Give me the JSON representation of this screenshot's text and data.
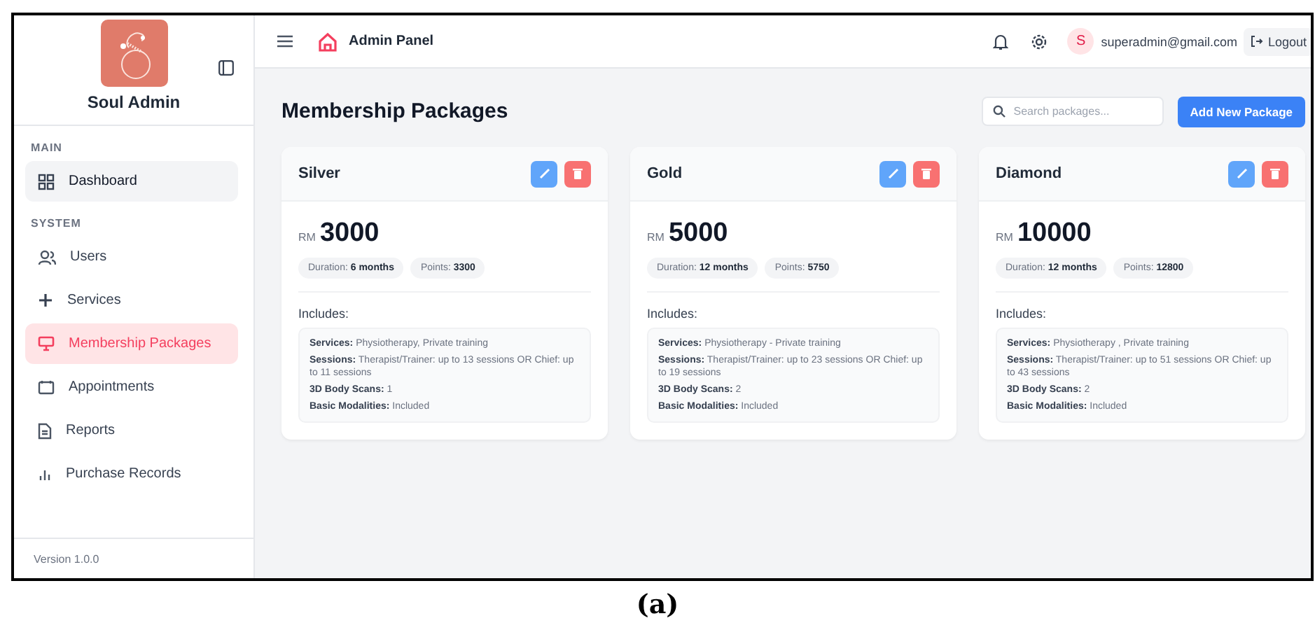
{
  "sidebar": {
    "brand": "Soul Admin",
    "sections": [
      {
        "title": "MAIN",
        "items": [
          {
            "label": "Dashboard",
            "selected": false,
            "hovered": true
          }
        ]
      },
      {
        "title": "SYSTEM",
        "items": [
          {
            "label": "Users",
            "selected": false,
            "hovered": false
          },
          {
            "label": "Services",
            "selected": false,
            "hovered": false
          },
          {
            "label": "Membership Packages",
            "selected": true,
            "hovered": false
          },
          {
            "label": "Appointments",
            "selected": false,
            "hovered": false
          },
          {
            "label": "Reports",
            "selected": false,
            "hovered": false
          },
          {
            "label": "Purchase Records",
            "selected": false,
            "hovered": false
          }
        ]
      }
    ],
    "version": "Version 1.0.0"
  },
  "topbar": {
    "title": "Admin Panel",
    "avatar": "S",
    "email": "superadmin@gmail.com",
    "logout": "Logout"
  },
  "page": {
    "title": "Membership Packages",
    "search": {
      "placeholder": "Search packages..."
    },
    "add_button": "Add New Package"
  },
  "packages": [
    {
      "name": "Silver",
      "currency": "RM",
      "price": "3000",
      "duration": "Duration: **6 months**",
      "points": "Points: **3300**",
      "includes_label": "Includes:",
      "details": [
        "**Services:** Physiotherapy, Private training",
        "**Sessions:** Therapist/Trainer: up to 13 sessions OR Chief: up to 11 sessions",
        "**3D Body Scans:** 1",
        "**Basic Modalities:** Included"
      ]
    },
    {
      "name": "Gold",
      "currency": "RM",
      "price": "5000",
      "duration": "Duration: **12 months**",
      "points": "Points: **5750**",
      "includes_label": "Includes:",
      "details": [
        "**Services:** Physiotherapy - Private training",
        "**Sessions:** Therapist/Trainer: up to 23 sessions OR Chief: up to 19 sessions",
        "**3D Body Scans:** 2",
        "**Basic Modalities:** Included"
      ]
    },
    {
      "name": "Diamond",
      "currency": "RM",
      "price": "10000",
      "duration": "Duration: **12 months**",
      "points": "Points: **12800**",
      "includes_label": "Includes:",
      "details": [
        "**Services:** Physiotherapy , Private training",
        "**Sessions:** Therapist/Trainer: up to 51 sessions OR Chief: up to 43 sessions",
        "**3D Body Scans:** 2",
        "**Basic Modalities:** Included"
      ]
    }
  ],
  "caption": "(a)"
}
